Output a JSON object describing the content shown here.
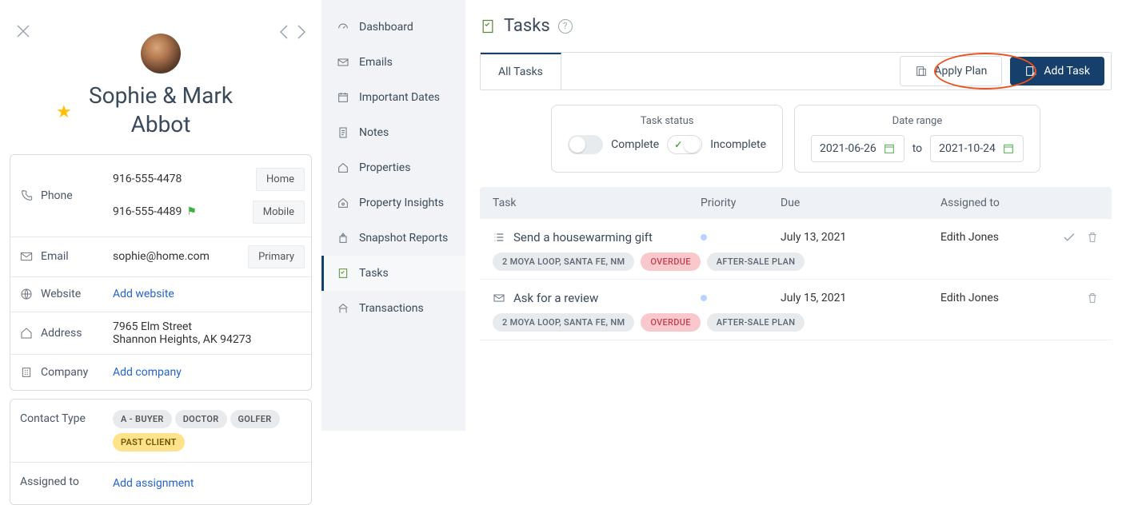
{
  "contact": {
    "name_line1": "Sophie & Mark",
    "name_line2": "Abbot",
    "starred": true,
    "phone_label": "Phone",
    "phones": [
      {
        "number": "916-555-4478",
        "type": "Home",
        "flag": false
      },
      {
        "number": "916-555-4489",
        "type": "Mobile",
        "flag": true
      }
    ],
    "email_label": "Email",
    "email_value": "sophie@home.com",
    "email_type": "Primary",
    "website_label": "Website",
    "website_action": "Add website",
    "address_label": "Address",
    "address_line1": "7965 Elm Street",
    "address_line2": "Shannon Heights, AK 94273",
    "company_label": "Company",
    "company_action": "Add company",
    "contact_type_label": "Contact Type",
    "contact_types": [
      "A - BUYER",
      "DOCTOR",
      "GOLFER",
      "PAST CLIENT"
    ],
    "assigned_label": "Assigned to",
    "assigned_action": "Add assignment"
  },
  "nav": {
    "items": [
      {
        "label": "Dashboard"
      },
      {
        "label": "Emails"
      },
      {
        "label": "Important Dates"
      },
      {
        "label": "Notes"
      },
      {
        "label": "Properties"
      },
      {
        "label": "Property Insights"
      },
      {
        "label": "Snapshot Reports"
      },
      {
        "label": "Tasks"
      },
      {
        "label": "Transactions"
      }
    ],
    "active_index": 7
  },
  "main": {
    "title": "Tasks",
    "tab_all": "All Tasks",
    "apply_plan": "Apply Plan",
    "add_task": "Add Task",
    "filters": {
      "status_title": "Task status",
      "complete_label": "Complete",
      "incomplete_label": "Incomplete",
      "daterange_title": "Date range",
      "date_from": "2021-06-26",
      "date_to": "2021-10-24",
      "to_label": "to"
    },
    "columns": {
      "task": "Task",
      "priority": "Priority",
      "due": "Due",
      "assigned": "Assigned to"
    },
    "tasks": [
      {
        "icon": "list",
        "title": "Send a housewarming gift",
        "due": "July 13, 2021",
        "assigned": "Edith Jones",
        "tags": [
          {
            "text": "2 MOYA LOOP, SANTA FE, NM",
            "style": "plain"
          },
          {
            "text": "OVERDUE",
            "style": "overdue"
          },
          {
            "text": "AFTER-SALE PLAN",
            "style": "plain"
          }
        ],
        "actions": [
          "complete",
          "delete"
        ]
      },
      {
        "icon": "mail",
        "title": "Ask for a review",
        "due": "July 15, 2021",
        "assigned": "Edith Jones",
        "tags": [
          {
            "text": "2 MOYA LOOP, SANTA FE, NM",
            "style": "plain"
          },
          {
            "text": "OVERDUE",
            "style": "overdue"
          },
          {
            "text": "AFTER-SALE PLAN",
            "style": "plain"
          }
        ],
        "actions": [
          "delete"
        ]
      }
    ]
  }
}
